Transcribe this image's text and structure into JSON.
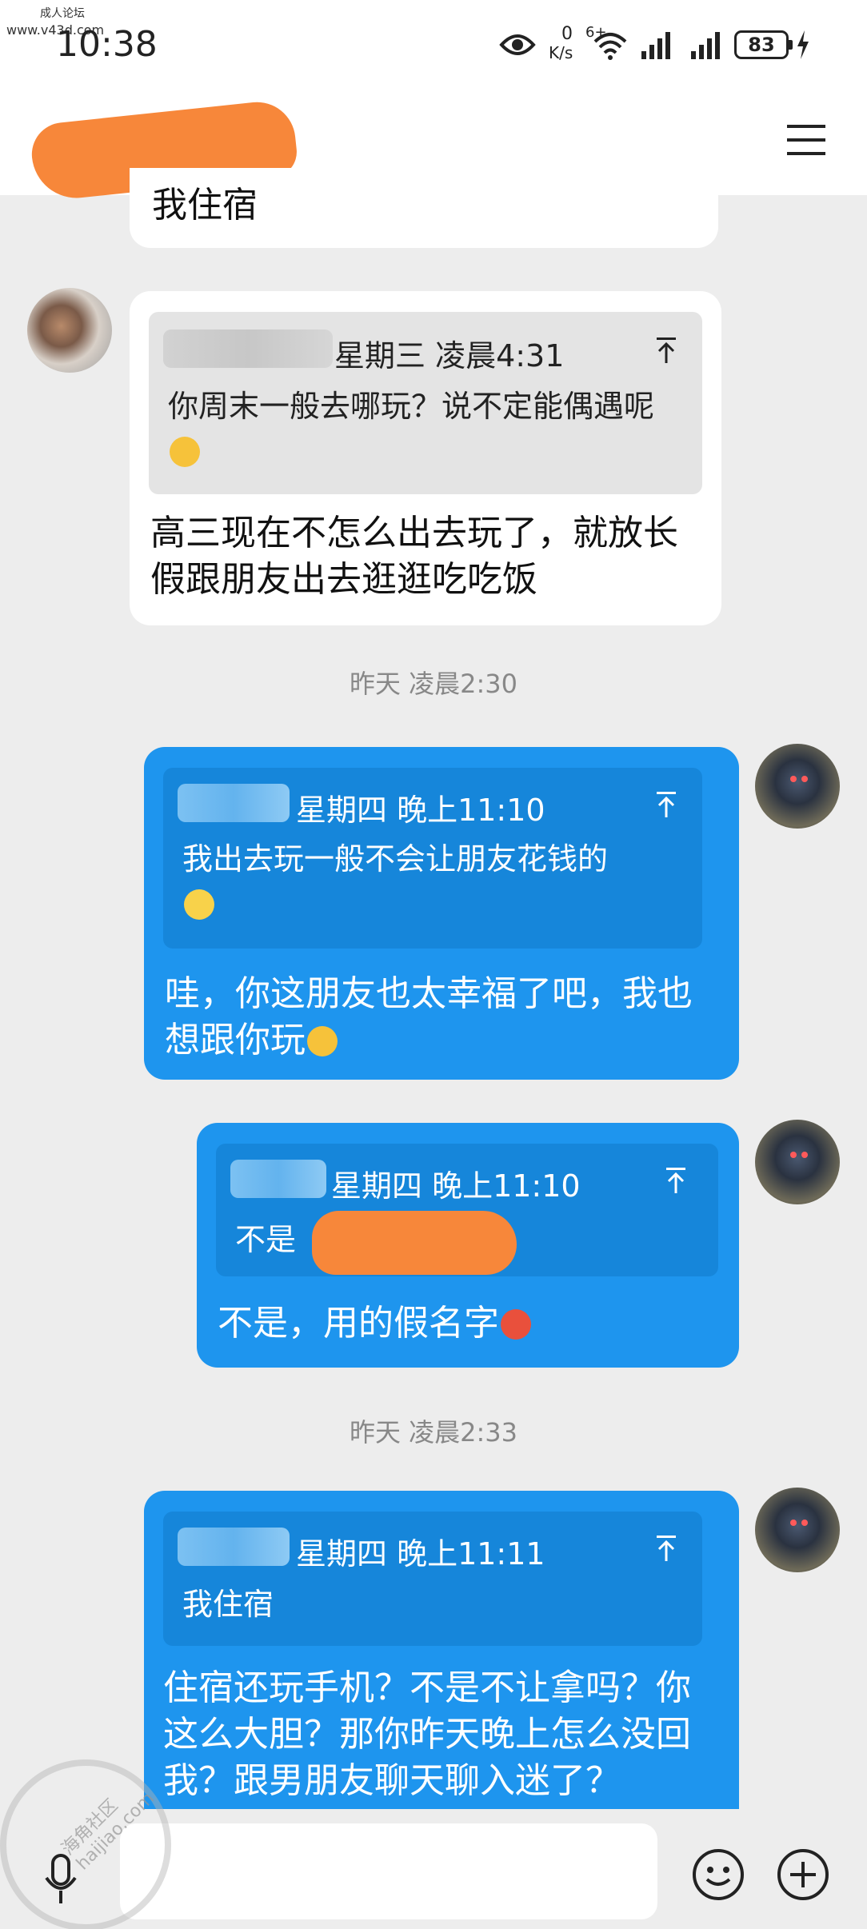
{
  "watermark": {
    "top_line1": "成人论坛",
    "top_line2": "www.v43d.com",
    "stamp_line1": "海角社区",
    "stamp_line2": "haijiao.com"
  },
  "status_bar": {
    "time": "10:38",
    "net_speed_value": "0",
    "net_speed_unit": "K/s",
    "wifi_label": "6+",
    "battery": "83",
    "icons": [
      "eye-icon",
      "wifi-icon",
      "signal-icon",
      "signal-icon",
      "battery-icon",
      "charging-icon"
    ]
  },
  "header": {
    "menu_icon": "hamburger-menu-icon",
    "back_icon": "back-chevron-icon"
  },
  "messages": [
    {
      "type": "incoming",
      "text": "我住宿"
    },
    {
      "type": "incoming",
      "quote": {
        "time": "星期三 凌晨4:31",
        "text": "你周末一般去哪玩？说不定能偶遇呢",
        "emoji": "thinking-face"
      },
      "text": "高三现在不怎么出去玩了，就放长假跟朋友出去逛逛吃吃饭"
    },
    {
      "type": "timestamp",
      "text": "昨天 凌晨2:30"
    },
    {
      "type": "outgoing",
      "quote": {
        "time": "星期四 晚上11:10",
        "text": "我出去玩一般不会让朋友花钱的",
        "emoji": "smiling-face"
      },
      "text": "哇，你这朋友也太幸福了吧，我也想跟你玩",
      "emoji": "tears-of-joy"
    },
    {
      "type": "outgoing",
      "quote": {
        "time": "星期四 晚上11:10",
        "text": "不是"
      },
      "text": "不是，用的假名字",
      "emoji": "flushed-face"
    },
    {
      "type": "timestamp",
      "text": "昨天 凌晨2:33"
    },
    {
      "type": "outgoing",
      "quote": {
        "time": "星期四 晚上11:11",
        "text": "我住宿"
      },
      "text": "住宿还玩手机？不是不让拿吗？你这么大胆？那你昨天晚上怎么没回我？跟男朋友聊天聊入迷了？"
    }
  ],
  "input_bar": {
    "voice_icon": "microphone-icon",
    "emoji_icon": "emoji-icon",
    "plus_icon": "plus-icon"
  },
  "colors": {
    "outgoing_bubble": "#1e95ee",
    "incoming_bubble": "#ffffff",
    "background": "#ededed",
    "redaction": "#f7873a"
  }
}
